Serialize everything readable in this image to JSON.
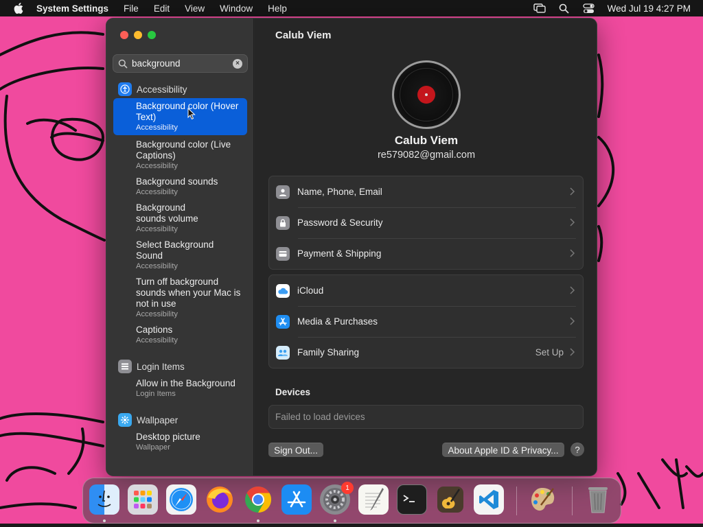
{
  "menubar": {
    "app_name": "System Settings",
    "menus": [
      "File",
      "Edit",
      "View",
      "Window",
      "Help"
    ],
    "clock": "Wed Jul 19  4:27 PM"
  },
  "search": {
    "value": "background"
  },
  "sidebar": {
    "accessibility_section": "Accessibility",
    "results": [
      {
        "title": "Background color (Hover Text)",
        "subtitle": "Accessibility"
      },
      {
        "title": "Background color (Live Captions)",
        "subtitle": "Accessibility"
      },
      {
        "title": "Background sounds",
        "subtitle": "Accessibility"
      },
      {
        "title": "Background sounds volume",
        "subtitle": "Accessibility"
      },
      {
        "title": "Select Background Sound",
        "subtitle": "Accessibility"
      },
      {
        "title": "Turn off background sounds when your Mac is not in use",
        "subtitle": "Accessibility"
      },
      {
        "title": "Captions",
        "subtitle": "Accessibility"
      }
    ],
    "login_section": "Login Items",
    "login_results": [
      {
        "title": "Allow in the Background",
        "subtitle": "Login Items"
      }
    ],
    "wallpaper_section": "Wallpaper",
    "wallpaper_results": [
      {
        "title": "Desktop picture",
        "subtitle": "Wallpaper"
      }
    ]
  },
  "content": {
    "title": "Calub Viem",
    "user_name": "Calub Viem",
    "user_email": "re579082@gmail.com",
    "account_rows": [
      {
        "label": "Name, Phone, Email"
      },
      {
        "label": "Password & Security"
      },
      {
        "label": "Payment & Shipping"
      }
    ],
    "services_rows": [
      {
        "label": "iCloud"
      },
      {
        "label": "Media & Purchases"
      },
      {
        "label": "Family Sharing",
        "value": "Set Up"
      }
    ],
    "devices_heading": "Devices",
    "devices_message": "Failed to load devices",
    "sign_out": "Sign Out...",
    "about": "About Apple ID & Privacy...",
    "help": "?"
  },
  "dock": {
    "apps": [
      "Finder",
      "Launchpad",
      "Safari",
      "Firefox",
      "Google Chrome",
      "App Store",
      "System Settings",
      "TextEdit",
      "Terminal",
      "GarageBand",
      "Visual Studio Code",
      "Art Studio",
      "Trash"
    ],
    "settings_badge": "1"
  },
  "colors": {
    "accent": "#0a5fd9",
    "desktop": "#f04a9e"
  }
}
